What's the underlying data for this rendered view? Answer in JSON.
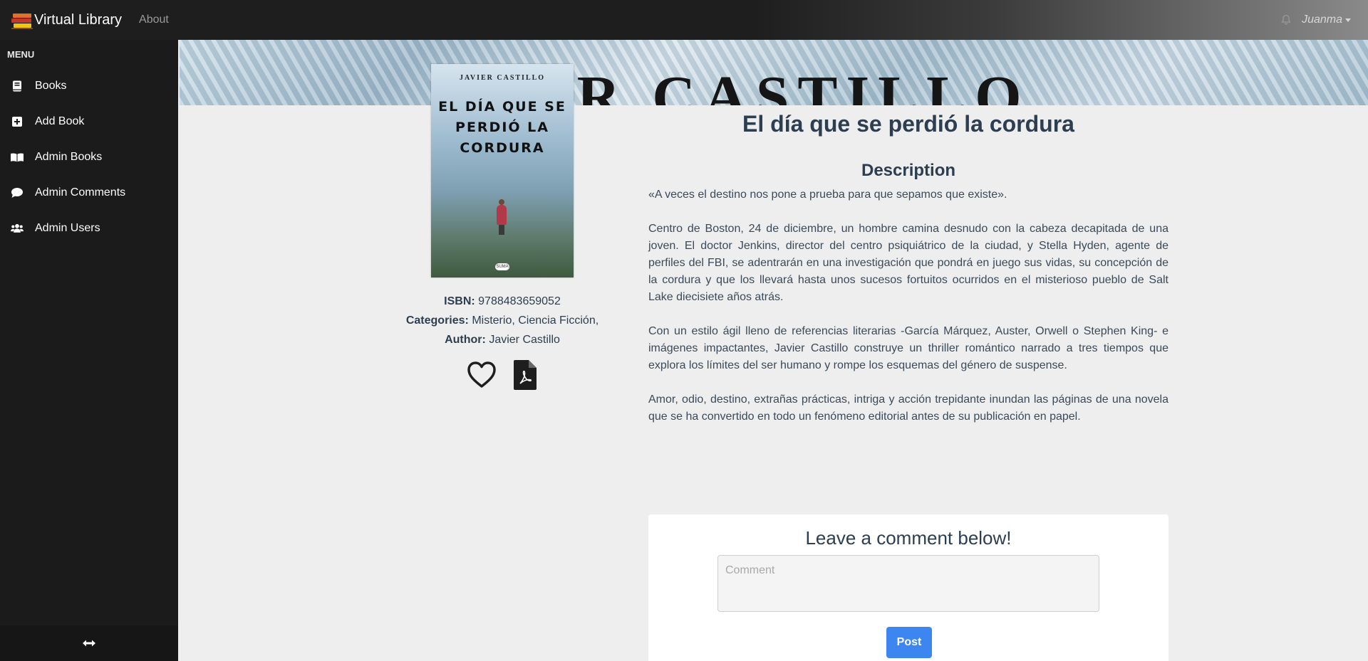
{
  "navbar": {
    "brand": "Virtual Library",
    "about": "About",
    "user": "Juanma"
  },
  "sidebar": {
    "title": "MENU",
    "items": [
      {
        "label": "Books",
        "icon": "book-icon"
      },
      {
        "label": "Add Book",
        "icon": "plus-square-icon"
      },
      {
        "label": "Admin Books",
        "icon": "open-book-icon"
      },
      {
        "label": "Admin Comments",
        "icon": "comment-icon"
      },
      {
        "label": "Admin Users",
        "icon": "users-icon"
      }
    ],
    "toggle_icon": "arrows-horizontal-icon"
  },
  "banner": {
    "text": "IER CASTILLO"
  },
  "cover": {
    "author": "JAVIER CASTILLO",
    "title": "EL DÍA QUE SE PERDIÓ LA CORDURA",
    "publisher": "SUMA"
  },
  "book": {
    "title": "El día que se perdió la cordura",
    "isbn_label": "ISBN:",
    "isbn": "9788483659052",
    "categories_label": "Categories:",
    "categories": "Misterio, Ciencia Ficción,",
    "author_label": "Author:",
    "author": "Javier Castillo",
    "favorite_icon": "heart-icon",
    "pdf_icon": "pdf-file-icon"
  },
  "description": {
    "heading": "Description",
    "paragraphs": [
      "«A veces el destino nos pone a prueba para que sepamos que existe».",
      "Centro de Boston, 24 de diciembre, un hombre camina desnudo con la cabeza decapitada de una joven. El doctor Jenkins, director del centro psiquiátrico de la ciudad, y Stella Hyden, agente de perfiles del FBI, se adentrarán en una investigación que pondrá en juego sus vidas, su concepción de la cordura y que los llevará hasta unos sucesos fortuitos ocurridos en el misterioso pueblo de Salt Lake diecisiete años atrás.",
      "Con un estilo ágil lleno de referencias literarias -García Márquez, Auster, Orwell o Stephen King- e imágenes impactantes, Javier Castillo construye un thriller romántico narrado a tres tiempos que explora los límites del ser humano y rompe los esquemas del género de suspense.",
      "Amor, odio, destino, extrañas prácticas, intriga y acción trepidante inundan las páginas de una novela que se ha convertido en todo un fenómeno editorial antes de su publicación en papel."
    ]
  },
  "comment": {
    "heading": "Leave a comment below!",
    "placeholder": "Comment",
    "value": "",
    "post_label": "Post"
  },
  "colors": {
    "sidebar_bg": "#1b1b1b",
    "page_bg": "#eeeeee",
    "heading": "#2c3e50",
    "post_button": "#3d86f0"
  }
}
